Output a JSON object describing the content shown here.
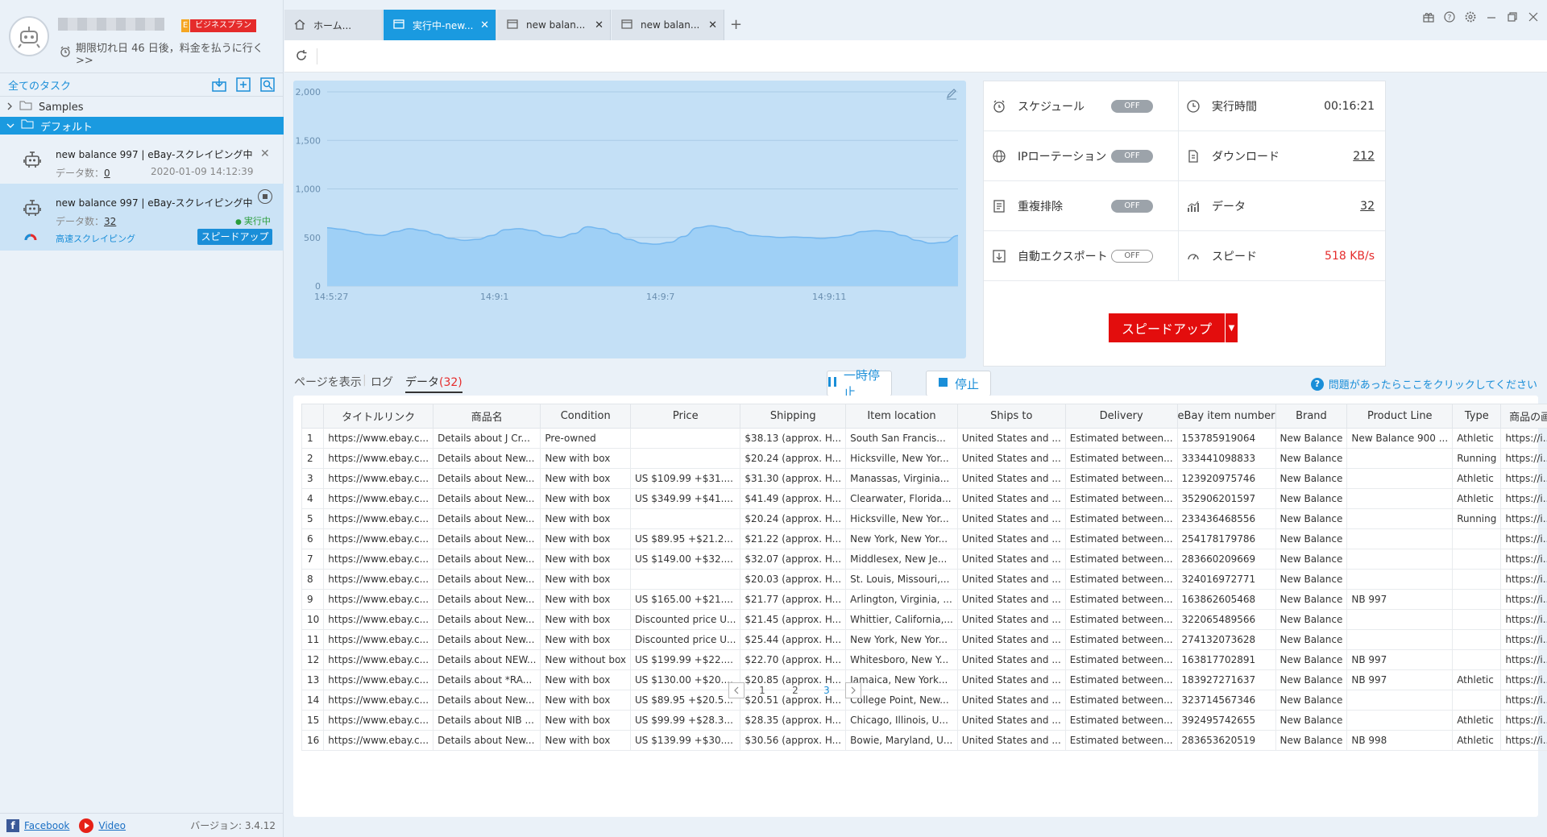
{
  "profile": {
    "plan_label": "ビジネスプラン",
    "plan_letter": "E",
    "expiry_text": "期限切れ日 46 日後，料金を払うに行く >>"
  },
  "sidebar": {
    "header_title": "全てのタスク",
    "folders": [
      {
        "label": "Samples",
        "expanded": false
      },
      {
        "label": "デフォルト",
        "expanded": true
      }
    ],
    "tasks": [
      {
        "title": "new balance 997 | eBay-スクレイピング中",
        "count_label": "データ数：",
        "count": "0",
        "date": "2020-01-09 14:12:39"
      },
      {
        "title": "new balance 997 | eBay-スクレイピング中",
        "count_label": "データ数：",
        "count": "32",
        "status": "実行中",
        "speed_mode": "高速スクレイピング",
        "speedup_label": "スピードアップ"
      }
    ],
    "footer": {
      "facebook": "Facebook",
      "video": "Video",
      "version": "バージョン: 3.4.12"
    }
  },
  "tabs": [
    {
      "label": "ホーム...",
      "icon": "home-icon",
      "active": false
    },
    {
      "label": "実行中-new...",
      "icon": "window-icon",
      "active": true
    },
    {
      "label": "new balan...",
      "icon": "window-icon",
      "active": false
    },
    {
      "label": "new balan...",
      "icon": "window-icon",
      "active": false
    }
  ],
  "chart_data": {
    "type": "area",
    "x_ticks": [
      "14:5:27",
      "14:9:1",
      "14:9:7",
      "14:9:11"
    ],
    "y_ticks": [
      "2,000",
      "1,500",
      "1,000",
      "500",
      "0"
    ],
    "ylim": [
      0,
      2000
    ],
    "values": [
      600,
      585,
      560,
      530,
      520,
      560,
      590,
      570,
      530,
      490,
      470,
      480,
      520,
      580,
      590,
      570,
      520,
      500,
      540,
      610,
      590,
      540,
      480,
      440,
      430,
      450,
      510,
      600,
      620,
      600,
      560,
      520,
      510,
      500,
      505,
      500,
      490,
      500,
      520,
      560,
      570,
      560,
      520,
      470,
      440,
      450,
      520
    ],
    "fill_color": "#9fd0f6",
    "line_color": "#74b7ef"
  },
  "stats": {
    "schedule": {
      "label": "スケジュール",
      "value": "OFF"
    },
    "runtime": {
      "label": "実行時間",
      "value": "00:16:21"
    },
    "ip_rotation": {
      "label": "IPローテーション",
      "value": "OFF"
    },
    "download": {
      "label": "ダウンロード",
      "value": "212"
    },
    "dedupe": {
      "label": "重複排除",
      "value": "OFF"
    },
    "data": {
      "label": "データ",
      "value": "32"
    },
    "auto_export": {
      "label": "自動エクスポート",
      "value": "OFF"
    },
    "speed": {
      "label": "スピード",
      "value": "518 KB/s"
    },
    "speedup_button": "スピードアップ"
  },
  "controls": {
    "view_page": "ページを表示",
    "log": "ログ",
    "data_tab": "データ",
    "data_count": "(32)",
    "pause": "一時停止",
    "stop": "停止",
    "help": "問題があったらここをクリックしてください"
  },
  "table": {
    "columns": [
      "",
      "タイトルリンク",
      "商品名",
      "Condition",
      "Price",
      "Shipping",
      "Item location",
      "Ships to",
      "Delivery",
      "eBay item number",
      "Brand",
      "Product Line",
      "Type",
      "商品の画"
    ],
    "rows": [
      [
        "1",
        "https://www.ebay.c...",
        "Details about  J Cr...",
        "Pre-owned",
        "",
        "$38.13 (approx. H...",
        "South San Francis...",
        "United States and ...",
        "Estimated between...",
        "153785919064",
        "New Balance",
        "New Balance 900 ...",
        "Athletic",
        "https://i...."
      ],
      [
        "2",
        "https://www.ebay.c...",
        "Details about  New...",
        "New with box",
        "",
        "$20.24 (approx. H...",
        "Hicksville, New Yor...",
        "United States and ...",
        "Estimated between...",
        "333441098833",
        "New Balance",
        "",
        "Running",
        "https://i...."
      ],
      [
        "3",
        "https://www.ebay.c...",
        "Details about  New...",
        "New with box",
        "US $109.99 +$31....",
        "$31.30 (approx. H...",
        "Manassas, Virginia...",
        "United States and ...",
        "Estimated between...",
        "123920975746",
        "New Balance",
        "",
        "Athletic",
        "https://i...."
      ],
      [
        "4",
        "https://www.ebay.c...",
        "Details about  New...",
        "New with box",
        "US $349.99 +$41....",
        "$41.49 (approx. H...",
        "Clearwater, Florida...",
        "United States and ...",
        "Estimated between...",
        "352906201597",
        "New Balance",
        "",
        "Athletic",
        "https://i...."
      ],
      [
        "5",
        "https://www.ebay.c...",
        "Details about  New...",
        "New with box",
        "",
        "$20.24 (approx. H...",
        "Hicksville, New Yor...",
        "United States and ...",
        "Estimated between...",
        "233436468556",
        "New Balance",
        "",
        "Running",
        "https://i...."
      ],
      [
        "6",
        "https://www.ebay.c...",
        "Details about  New...",
        "New with box",
        "US $89.95 +$21.2...",
        "$21.22 (approx. H...",
        "New York, New Yor...",
        "United States and ...",
        "Estimated between...",
        "254178179786",
        "New Balance",
        "",
        "",
        "https://i...."
      ],
      [
        "7",
        "https://www.ebay.c...",
        "Details about  New...",
        "New with box",
        "US $149.00 +$32....",
        "$32.07 (approx. H...",
        "Middlesex, New Je...",
        "United States and ...",
        "Estimated between...",
        "283660209669",
        "New Balance",
        "",
        "",
        "https://i...."
      ],
      [
        "8",
        "https://www.ebay.c...",
        "Details about  New...",
        "New with box",
        "",
        "$20.03 (approx. H...",
        "St. Louis, Missouri,...",
        "United States and ...",
        "Estimated between...",
        "324016972771",
        "New Balance",
        "",
        "",
        "https://i...."
      ],
      [
        "9",
        "https://www.ebay.c...",
        "Details about  New...",
        "New with box",
        "US $165.00 +$21....",
        "$21.77 (approx. H...",
        "Arlington, Virginia, ...",
        "United States and ...",
        "Estimated between...",
        "163862605468",
        "New Balance",
        "NB 997",
        "",
        "https://i...."
      ],
      [
        "10",
        "https://www.ebay.c...",
        "Details about  New...",
        "New with box",
        "Discounted price U...",
        "$21.45 (approx. H...",
        "Whittier, California,...",
        "United States and ...",
        "Estimated between...",
        "322065489566",
        "New Balance",
        "",
        "",
        "https://i...."
      ],
      [
        "11",
        "https://www.ebay.c...",
        "Details about  New...",
        "New with box",
        "Discounted price U...",
        "$25.44 (approx. H...",
        "New York, New Yor...",
        "United States and ...",
        "Estimated between...",
        "274132073628",
        "New Balance",
        "",
        "",
        "https://i...."
      ],
      [
        "12",
        "https://www.ebay.c...",
        "Details about  NEW...",
        "New without box",
        "US $199.99 +$22....",
        "$22.70 (approx. H...",
        "Whitesboro, New Y...",
        "United States and ...",
        "Estimated between...",
        "163817702891",
        "New Balance",
        "NB 997",
        "",
        "https://i...."
      ],
      [
        "13",
        "https://www.ebay.c...",
        "Details about  *RA...",
        "New with box",
        "US $130.00 +$20....",
        "$20.85 (approx. H...",
        "Jamaica, New York...",
        "United States and ...",
        "Estimated between...",
        "183927271637",
        "New Balance",
        "NB 997",
        "Athletic",
        "https://i...."
      ],
      [
        "14",
        "https://www.ebay.c...",
        "Details about  New...",
        "New with box",
        "US $89.95 +$20.5...",
        "$20.51 (approx. H...",
        "College Point, New...",
        "United States and ...",
        "Estimated between...",
        "323714567346",
        "New Balance",
        "",
        "",
        "https://i...."
      ],
      [
        "15",
        "https://www.ebay.c...",
        "Details about  NIB ...",
        "New with box",
        "US $99.99 +$28.3...",
        "$28.35 (approx. H...",
        "Chicago, Illinois, U...",
        "United States and ...",
        "Estimated between...",
        "392495742655",
        "New Balance",
        "",
        "Athletic",
        "https://i...."
      ],
      [
        "16",
        "https://www.ebay.c...",
        "Details about  New...",
        "New with box",
        "US $139.99 +$30....",
        "$30.56 (approx. H...",
        "Bowie, Maryland, U...",
        "United States and ...",
        "Estimated between...",
        "283653620519",
        "New Balance",
        "NB 998",
        "Athletic",
        "https://i...."
      ]
    ]
  },
  "pager": {
    "pages": [
      "1",
      "2",
      "3"
    ],
    "current": "3"
  }
}
